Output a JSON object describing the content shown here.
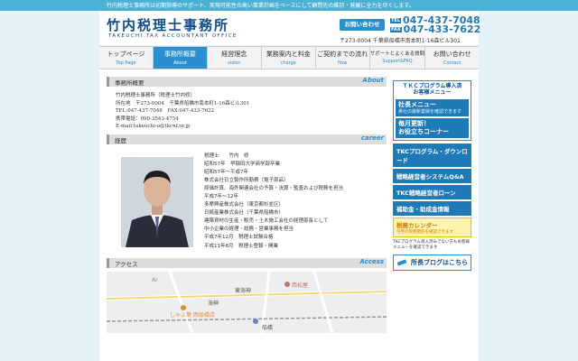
{
  "topbar": {
    "text": "竹内税理士事務所は初期指導のサポート、実現可能性の高い事業計画をベースにして顧問先の維持・発展に全力を尽くします。"
  },
  "header": {
    "logo_jp": "竹内税理士事務所",
    "logo_en": "TAKEUCHI TAX ACCOUNTANT OFFICE",
    "contact_button": "お問い合わせ",
    "tel_label": "TEL",
    "tel": "047-437-7048",
    "fax_label": "FAX",
    "fax": "047-433-7622",
    "address": "〒273-0004 千葉県船橋市南本町1-16森ビル301"
  },
  "nav": [
    {
      "jp": "トップページ",
      "en": "Top Page"
    },
    {
      "jp": "事務所概要",
      "en": "About"
    },
    {
      "jp": "経営理念",
      "en": "vision"
    },
    {
      "jp": "業務案内と料金",
      "en": "charge"
    },
    {
      "jp": "ご契約までの流れ",
      "en": "flow"
    },
    {
      "jp": "サポートとよくある質問",
      "en": "Support&FAQ"
    },
    {
      "jp": "お問い合わせ",
      "en": "Contact"
    }
  ],
  "overview": {
    "title": "事務所概要",
    "title_en": "About",
    "lines": [
      "竹内税理士事務所（税理士竹内修）",
      "所在地　〒273-0004　千葉県船橋市南本町1-16森ビル301",
      "TEL:047-437-7048　FAX:047-433-7622",
      "携帯電話：090-3543-4754",
      "E-mail:takeuchi-o@tkcnf.or.jp"
    ]
  },
  "career": {
    "title": "経歴",
    "title_en": "career",
    "lines": [
      "税理士　　竹内　修",
      "昭和57年　早稲田大学商学部卒業",
      "昭和57年～平成7年",
      "株式会社日立製作所勤務（電子部品）",
      "原価計算、海外関連会社の予算・決算・監査および税務を担当",
      "平成7年～12年",
      "多摩興産株式会社（東京都杉並区）",
      "日統産業株式会社（千葉県船橋市）",
      "建築資材の生産・販売・土木施工会社の経理部長として",
      "中小企業の経理・総務・営業事務を担当",
      "平成7年12月　税理士試験合格",
      "平成11年8月　税理士登録・開業"
    ]
  },
  "access": {
    "title": "アクセス",
    "title_en": "Access",
    "map_labels": {
      "shop1": "Ar",
      "shop2": "西松屋",
      "shop3": "しゃぶ葉 西船橋店",
      "temple": "海神",
      "line1": "東海神",
      "station": "船橋"
    }
  },
  "sidebar": {
    "tkc_title": "ＴＫＣプログラム導入済\nお客様メニュー",
    "btn1_main": "社長メニュー",
    "btn1_sub": "貴社の最新業績を確認できます",
    "btn2_main": "毎月更新！\nお役立ちコーナー",
    "link1": "TKCプログラム・ダウンロード",
    "link2": "戦略経営者システムQ&A",
    "link3": "TKC戦略経営者ローン",
    "link4": "補助金・助成金情報",
    "cal_main": "税務カレンダー",
    "cal_sub": "今月の税務関係を確認できます",
    "note": "TKCプログラム導入済みでない方もお客様メニューを確認できます",
    "blog": "所長ブログはこちら"
  },
  "colors": {
    "accent": "#2b8fcf",
    "brand": "#0d4c8a",
    "bg": "#e3f3f8"
  }
}
